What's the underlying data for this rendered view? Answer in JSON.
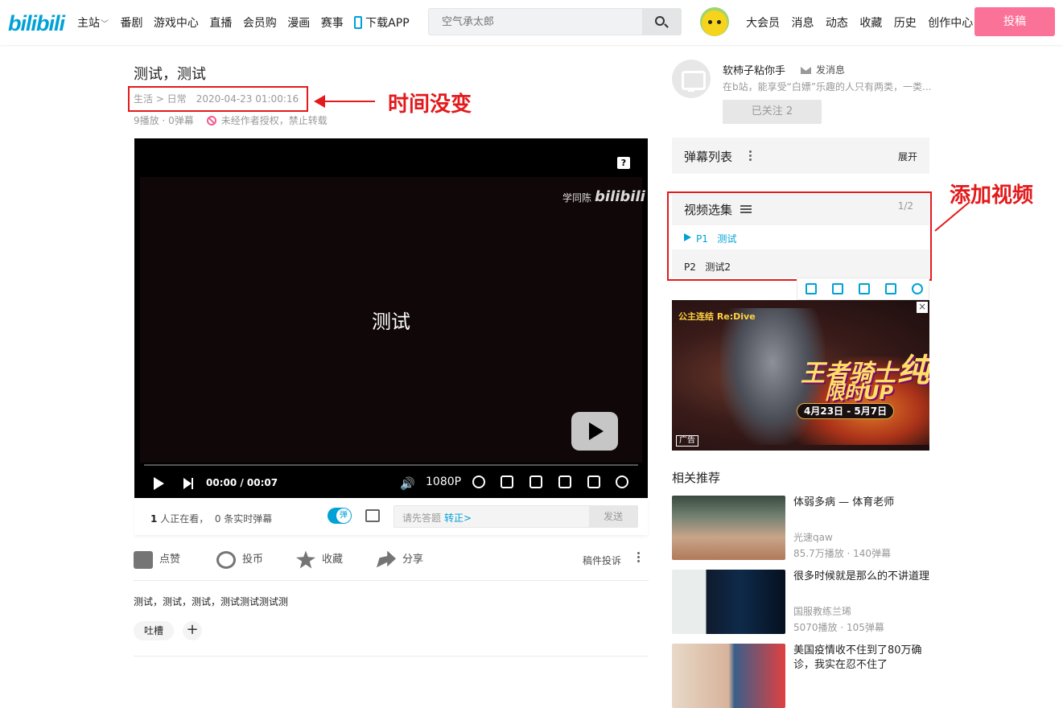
{
  "header": {
    "logo": "bilibili",
    "nav": [
      "主站",
      "番剧",
      "游戏中心",
      "直播",
      "会员购",
      "漫画",
      "赛事",
      "下载APP"
    ],
    "search_placeholder": "空气承太郎",
    "right_nav": [
      "大会员",
      "消息",
      "动态",
      "收藏",
      "历史",
      "创作中心"
    ],
    "upload": "投稿"
  },
  "video": {
    "title": "测试，测试",
    "breadcrumb": "生活 > 日常",
    "date": "2020-04-23 01:00:16",
    "stats": "9播放 · 0弹幕",
    "copyright": "未经作者授权，禁止转载"
  },
  "annotations": {
    "time_note": "时间没变",
    "episode_note": "添加视频"
  },
  "player": {
    "watermark_user": "学同陈",
    "watermark_logo": "bilibili",
    "subtitle": "测试",
    "time": "00:00 / 00:07",
    "quality": "1080P",
    "help": "?"
  },
  "danmaku_bar": {
    "viewers_count": "1",
    "viewers_text": "人正在看，",
    "realtime": "0 条实时弹幕",
    "input_placeholder": "请先答题",
    "correct_link": "转正>",
    "send": "发送"
  },
  "actions": {
    "like": "点赞",
    "coin": "投币",
    "favorite": "收藏",
    "share": "分享",
    "report": "稿件投诉"
  },
  "description": "测试，测试，测试，测试测试测试测",
  "tags": {
    "tag1": "吐槽",
    "add": "+"
  },
  "uploader": {
    "name": "软柿子粘你手",
    "message": "发消息",
    "desc": "在b站，能享受“白嫖”乐趣的人只有两类，一类...",
    "follow": "已关注 2"
  },
  "danmaku_list": {
    "title": "弹幕列表",
    "expand": "展开"
  },
  "episodes": {
    "title": "视频选集",
    "count": "1/2",
    "items": [
      {
        "p": "P1",
        "name": "测试"
      },
      {
        "p": "P2",
        "name": "测试2"
      }
    ]
  },
  "ad": {
    "title": "王者骑士",
    "title2": "纯",
    "sub": "限时UP",
    "date": "4月23日 - 5月7日",
    "logo": "公主连结 Re:Dive",
    "label": "广告",
    "close": "×"
  },
  "recommend": {
    "title": "相关推荐",
    "items": [
      {
        "title": "体弱多病 — 体育老师",
        "up": "光速qaw",
        "stats": "85.7万播放 · 140弹幕"
      },
      {
        "title": "很多时候就是那么的不讲道理",
        "up": "国服教练兰琋",
        "stats": "5070播放 · 105弹幕"
      },
      {
        "title": "美国疫情收不住到了80万确诊，我实在忍不住了",
        "up": "",
        "stats": ""
      }
    ]
  }
}
